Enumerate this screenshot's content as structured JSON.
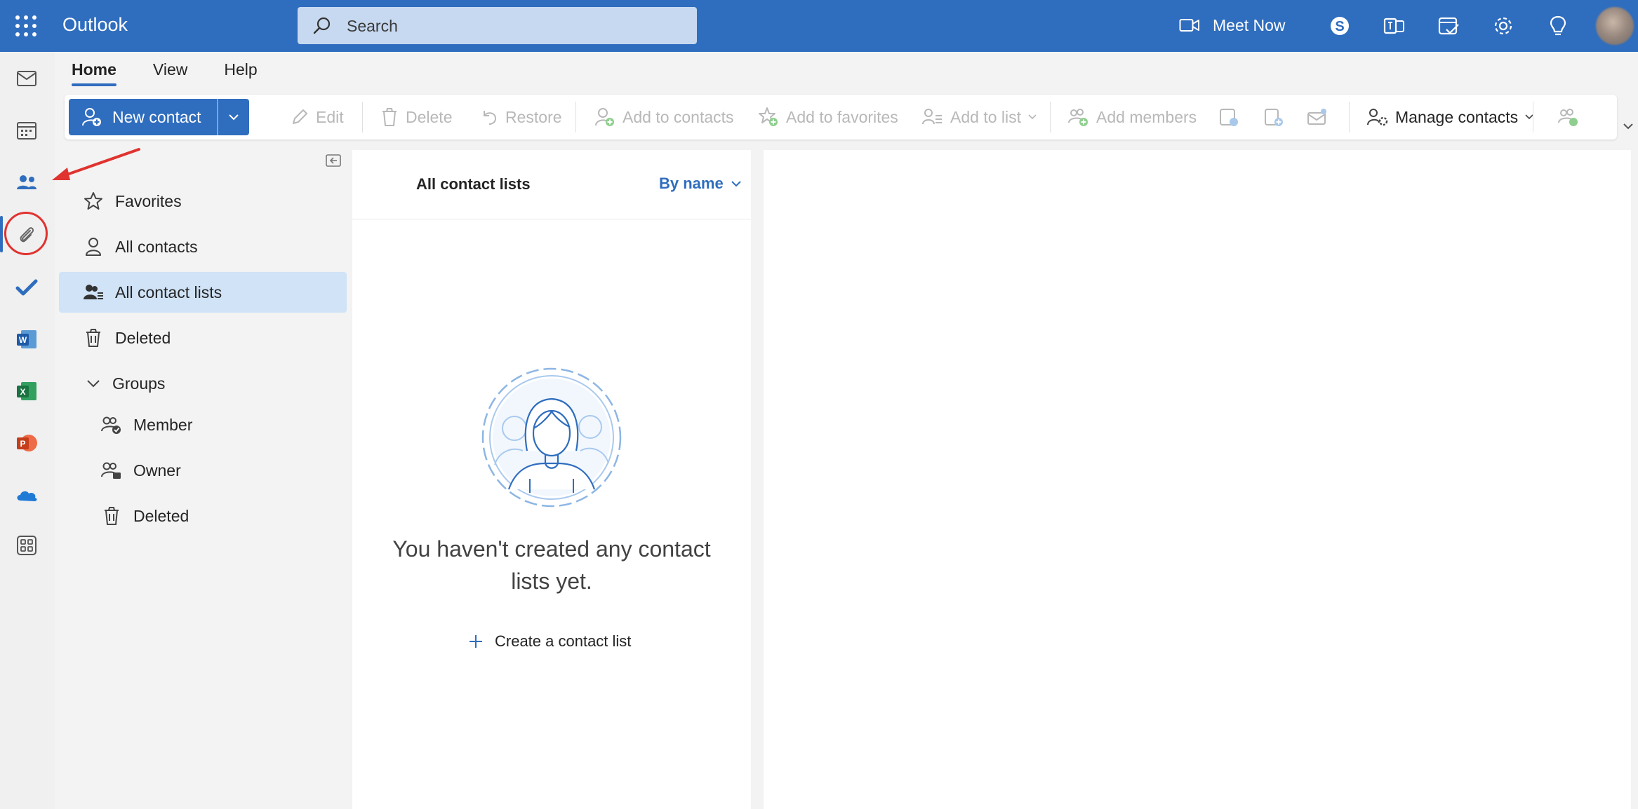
{
  "app": {
    "title": "Outlook"
  },
  "search": {
    "placeholder": "Search"
  },
  "topbar": {
    "meet_now": "Meet Now"
  },
  "ribbon": {
    "tabs": [
      "Home",
      "View",
      "Help"
    ],
    "active_tab": "Home",
    "new_contact": "New contact",
    "edit": "Edit",
    "delete": "Delete",
    "restore": "Restore",
    "add_to_contacts": "Add to contacts",
    "add_to_favorites": "Add to favorites",
    "add_to_list": "Add to list",
    "add_members": "Add members",
    "manage_contacts": "Manage contacts"
  },
  "rail": {
    "items": [
      "mail-icon",
      "calendar-icon",
      "people-icon",
      "files-icon",
      "todo-icon",
      "word-icon",
      "excel-icon",
      "powerpoint-icon",
      "onedrive-icon",
      "more-apps-icon"
    ],
    "active": "people-icon"
  },
  "folders": {
    "favorites": "Favorites",
    "all_contacts": "All contacts",
    "all_contact_lists": "All contact lists",
    "deleted": "Deleted",
    "groups": "Groups",
    "member": "Member",
    "owner": "Owner",
    "groups_deleted": "Deleted"
  },
  "list": {
    "title": "All contact lists",
    "sort": "By name",
    "empty_message": "You haven't created any contact lists yet.",
    "create": "Create a contact list"
  },
  "colors": {
    "brand": "#2f6dbe",
    "selected_bg": "#d0e3f7",
    "annotation": "#e0332f",
    "disabled_text": "#b8b8b8"
  }
}
